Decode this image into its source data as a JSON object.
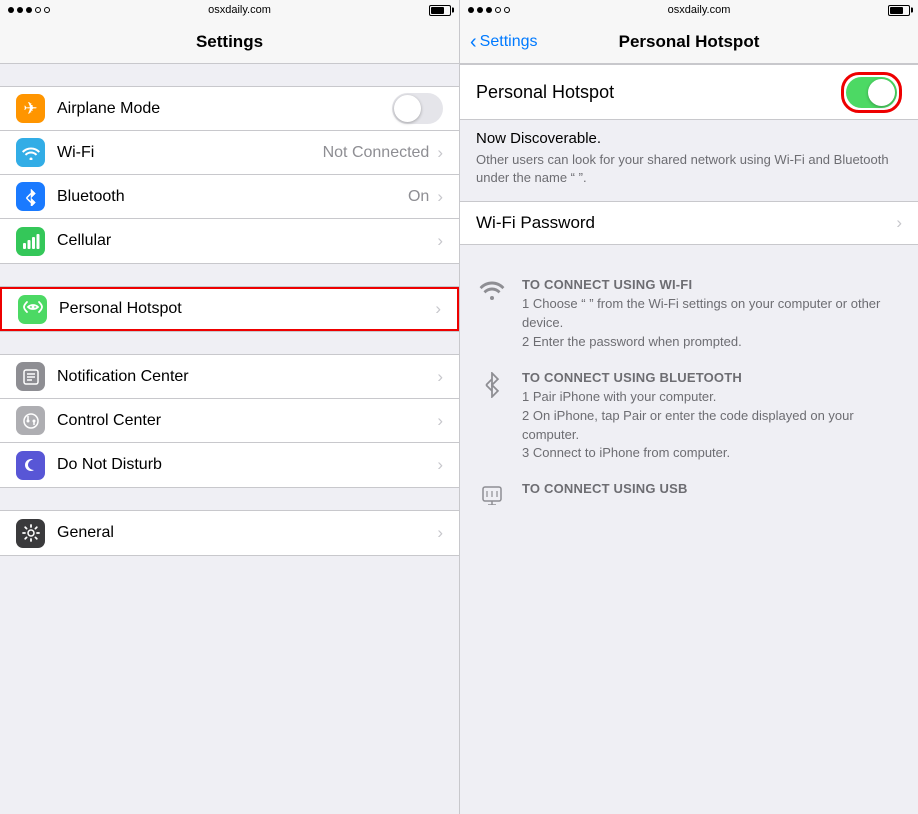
{
  "left": {
    "statusBar": {
      "dots": [
        true,
        true,
        true,
        false,
        false
      ],
      "url": "osxdaily.com",
      "battery": "70"
    },
    "navBar": {
      "title": "Settings"
    },
    "sections": [
      {
        "rows": [
          {
            "id": "airplane",
            "label": "Airplane Mode",
            "icon_bg": "bg-orange",
            "icon": "✈",
            "toggle": true,
            "toggle_on": false
          },
          {
            "id": "wifi",
            "label": "Wi-Fi",
            "icon_bg": "bg-blue2",
            "icon": "wifi",
            "value": "Not Connected",
            "chevron": true
          },
          {
            "id": "bluetooth",
            "label": "Bluetooth",
            "icon_bg": "bg-blue-dark",
            "icon": "bt",
            "value": "On",
            "chevron": true
          },
          {
            "id": "cellular",
            "label": "Cellular",
            "icon_bg": "bg-green2",
            "icon": "cell",
            "chevron": true
          }
        ]
      },
      {
        "rows": [
          {
            "id": "hotspot",
            "label": "Personal Hotspot",
            "icon_bg": "bg-green",
            "icon": "link",
            "chevron": true,
            "highlighted": true
          }
        ]
      },
      {
        "rows": [
          {
            "id": "notification",
            "label": "Notification Center",
            "icon_bg": "bg-gray",
            "icon": "notif",
            "chevron": true
          },
          {
            "id": "control",
            "label": "Control Center",
            "icon_bg": "bg-gray2",
            "icon": "ctrl",
            "chevron": true
          },
          {
            "id": "dnd",
            "label": "Do Not Disturb",
            "icon_bg": "bg-indigo",
            "icon": "moon",
            "chevron": true
          }
        ]
      },
      {
        "rows": [
          {
            "id": "general",
            "label": "General",
            "icon_bg": "bg-dark",
            "icon": "gear",
            "chevron": true
          }
        ]
      }
    ]
  },
  "right": {
    "statusBar": {
      "dots": [
        true,
        true,
        true,
        false,
        false
      ],
      "url": "osxdaily.com",
      "battery": "70"
    },
    "navBar": {
      "back_label": "Settings",
      "title": "Personal Hotspot"
    },
    "hotspot": {
      "toggle_label": "Personal Hotspot",
      "toggle_on": true,
      "discoverable_title": "Now Discoverable.",
      "discoverable_text": "Other users can look for your shared network using Wi-Fi and Bluetooth under the name “              ”.",
      "wifi_password_label": "Wi-Fi Password",
      "connect_sections": [
        {
          "icon": "wifi",
          "title": "TO CONNECT USING WI-FI",
          "steps": [
            "1 Choose “              ” from the Wi-Fi settings on your computer or other device.",
            "2 Enter the password when prompted."
          ]
        },
        {
          "icon": "bt",
          "title": "TO CONNECT USING BLUETOOTH",
          "steps": [
            "1 Pair iPhone with your computer.",
            "2 On iPhone, tap Pair or enter the code displayed on your computer.",
            "3 Connect to iPhone from computer."
          ]
        },
        {
          "icon": "usb",
          "title": "TO CONNECT USING USB",
          "steps": []
        }
      ]
    }
  }
}
